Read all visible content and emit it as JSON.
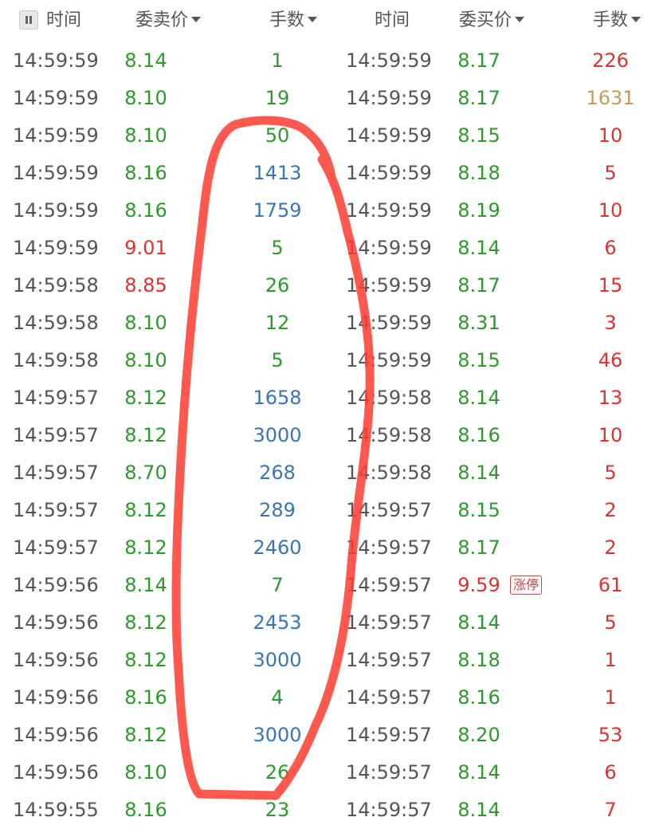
{
  "colors": {
    "green": "#2a9a2a",
    "red": "#e03030",
    "blue": "#3a74b8",
    "gold": "#c89a5a",
    "gray": "#555555",
    "annotation_red": "#ff3b30"
  },
  "header": {
    "time_label": "时间",
    "sell_price_label": "委卖价",
    "sell_volume_label": "手数",
    "time_label_2": "时间",
    "buy_price_label": "委买价",
    "buy_volume_label": "手数"
  },
  "limit_up_badge": "涨停",
  "rows": [
    {
      "t1": "14:59:59",
      "p1": "8.14",
      "p1c": "green",
      "v1": "1",
      "v1c": "green",
      "t2": "14:59:59",
      "p2": "8.17",
      "p2c": "green",
      "v2": "226",
      "v2c": "red"
    },
    {
      "t1": "14:59:59",
      "p1": "8.10",
      "p1c": "green",
      "v1": "19",
      "v1c": "green",
      "t2": "14:59:59",
      "p2": "8.17",
      "p2c": "green",
      "v2": "1631",
      "v2c": "gold"
    },
    {
      "t1": "14:59:59",
      "p1": "8.10",
      "p1c": "green",
      "v1": "50",
      "v1c": "green",
      "t2": "14:59:59",
      "p2": "8.15",
      "p2c": "green",
      "v2": "10",
      "v2c": "red"
    },
    {
      "t1": "14:59:59",
      "p1": "8.16",
      "p1c": "green",
      "v1": "1413",
      "v1c": "blue",
      "t2": "14:59:59",
      "p2": "8.18",
      "p2c": "green",
      "v2": "5",
      "v2c": "red"
    },
    {
      "t1": "14:59:59",
      "p1": "8.16",
      "p1c": "green",
      "v1": "1759",
      "v1c": "blue",
      "t2": "14:59:59",
      "p2": "8.19",
      "p2c": "green",
      "v2": "10",
      "v2c": "red"
    },
    {
      "t1": "14:59:59",
      "p1": "9.01",
      "p1c": "red",
      "v1": "5",
      "v1c": "green",
      "t2": "14:59:59",
      "p2": "8.14",
      "p2c": "green",
      "v2": "6",
      "v2c": "red"
    },
    {
      "t1": "14:59:58",
      "p1": "8.85",
      "p1c": "red",
      "v1": "26",
      "v1c": "green",
      "t2": "14:59:59",
      "p2": "8.17",
      "p2c": "green",
      "v2": "15",
      "v2c": "red"
    },
    {
      "t1": "14:59:58",
      "p1": "8.10",
      "p1c": "green",
      "v1": "12",
      "v1c": "green",
      "t2": "14:59:59",
      "p2": "8.31",
      "p2c": "green",
      "v2": "3",
      "v2c": "red"
    },
    {
      "t1": "14:59:58",
      "p1": "8.10",
      "p1c": "green",
      "v1": "5",
      "v1c": "green",
      "t2": "14:59:59",
      "p2": "8.15",
      "p2c": "green",
      "v2": "46",
      "v2c": "red"
    },
    {
      "t1": "14:59:57",
      "p1": "8.12",
      "p1c": "green",
      "v1": "1658",
      "v1c": "blue",
      "t2": "14:59:58",
      "p2": "8.14",
      "p2c": "green",
      "v2": "13",
      "v2c": "red"
    },
    {
      "t1": "14:59:57",
      "p1": "8.12",
      "p1c": "green",
      "v1": "3000",
      "v1c": "blue",
      "t2": "14:59:58",
      "p2": "8.16",
      "p2c": "green",
      "v2": "10",
      "v2c": "red"
    },
    {
      "t1": "14:59:57",
      "p1": "8.70",
      "p1c": "green",
      "v1": "268",
      "v1c": "blue",
      "t2": "14:59:58",
      "p2": "8.14",
      "p2c": "green",
      "v2": "5",
      "v2c": "red"
    },
    {
      "t1": "14:59:57",
      "p1": "8.12",
      "p1c": "green",
      "v1": "289",
      "v1c": "blue",
      "t2": "14:59:57",
      "p2": "8.15",
      "p2c": "green",
      "v2": "2",
      "v2c": "red"
    },
    {
      "t1": "14:59:57",
      "p1": "8.12",
      "p1c": "green",
      "v1": "2460",
      "v1c": "blue",
      "t2": "14:59:57",
      "p2": "8.17",
      "p2c": "green",
      "v2": "2",
      "v2c": "red"
    },
    {
      "t1": "14:59:56",
      "p1": "8.14",
      "p1c": "green",
      "v1": "7",
      "v1c": "green",
      "t2": "14:59:57",
      "p2": "9.59",
      "p2c": "red",
      "v2": "61",
      "v2c": "red",
      "badge": true
    },
    {
      "t1": "14:59:56",
      "p1": "8.12",
      "p1c": "green",
      "v1": "2453",
      "v1c": "blue",
      "t2": "14:59:57",
      "p2": "8.14",
      "p2c": "green",
      "v2": "5",
      "v2c": "red"
    },
    {
      "t1": "14:59:56",
      "p1": "8.12",
      "p1c": "green",
      "v1": "3000",
      "v1c": "blue",
      "t2": "14:59:57",
      "p2": "8.18",
      "p2c": "green",
      "v2": "1",
      "v2c": "red"
    },
    {
      "t1": "14:59:56",
      "p1": "8.16",
      "p1c": "green",
      "v1": "4",
      "v1c": "green",
      "t2": "14:59:57",
      "p2": "8.16",
      "p2c": "green",
      "v2": "1",
      "v2c": "red"
    },
    {
      "t1": "14:59:56",
      "p1": "8.12",
      "p1c": "green",
      "v1": "3000",
      "v1c": "blue",
      "t2": "14:59:57",
      "p2": "8.20",
      "p2c": "green",
      "v2": "53",
      "v2c": "red"
    },
    {
      "t1": "14:59:56",
      "p1": "8.10",
      "p1c": "green",
      "v1": "26",
      "v1c": "green",
      "t2": "14:59:57",
      "p2": "8.14",
      "p2c": "green",
      "v2": "6",
      "v2c": "red"
    },
    {
      "t1": "14:59:55",
      "p1": "8.16",
      "p1c": "green",
      "v1": "23",
      "v1c": "green",
      "t2": "14:59:57",
      "p2": "8.14",
      "p2c": "green",
      "v2": "7",
      "v2c": "red"
    }
  ]
}
